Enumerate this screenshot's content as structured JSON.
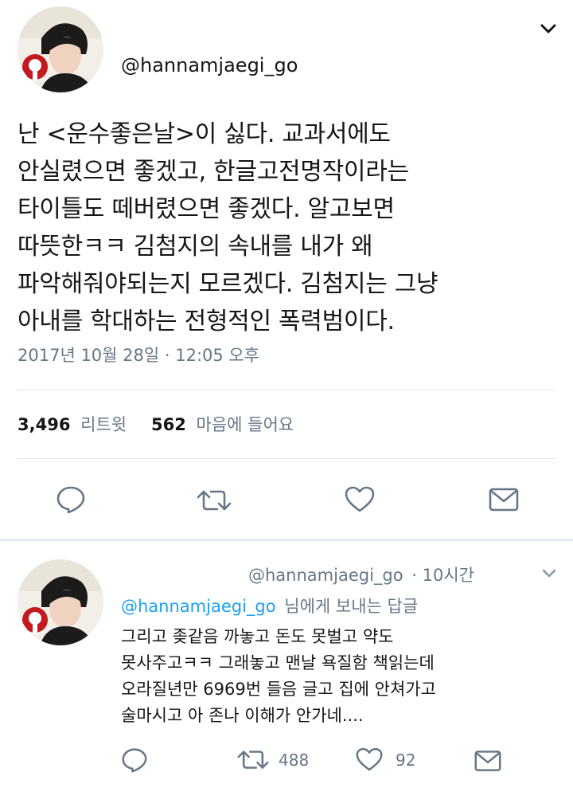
{
  "tweet": {
    "handle": "@hannamjaegi_go",
    "text": "난 <운수좋은날>이 싫다. 교과서에도\n안실렸으면 좋겠고, 한글고전명작이라는\n타이틀도 떼버렸으면 좋겠다. 알고보면\n따뜻한ㅋㅋ 김첨지의 속내를 내가 왜\n파악해줘야되는지 모르겠다. 김첨지는 그냥\n아내를 학대하는 전형적인 폭력범이다.",
    "timestamp": "2017년 10월 28일 · 12:05 오후",
    "retweet_count": "3,496",
    "retweet_label": "리트윗",
    "like_count": "562",
    "like_label": "마음에 들어요"
  },
  "reply": {
    "handle": "@hannamjaegi_go",
    "time": "· 10시간",
    "replying_to_handle": "@hannamjaegi_go",
    "replying_to_suffix": "님에게 보내는 답글",
    "text": "그리고 좆같음 까놓고 돈도 못벌고 약도\n못사주고ㅋㅋ 그래놓고 맨날 욕질함 책읽는데\n오라질년만 6969번 들음 글고 집에 안쳐가고\n술마시고 아 존나 이해가 안가네....",
    "retweet_count": "488",
    "like_count": "92"
  },
  "colors": {
    "text": "#14171a",
    "muted": "#657786",
    "link": "#1da1f2",
    "divider": "#e1e8ed"
  }
}
